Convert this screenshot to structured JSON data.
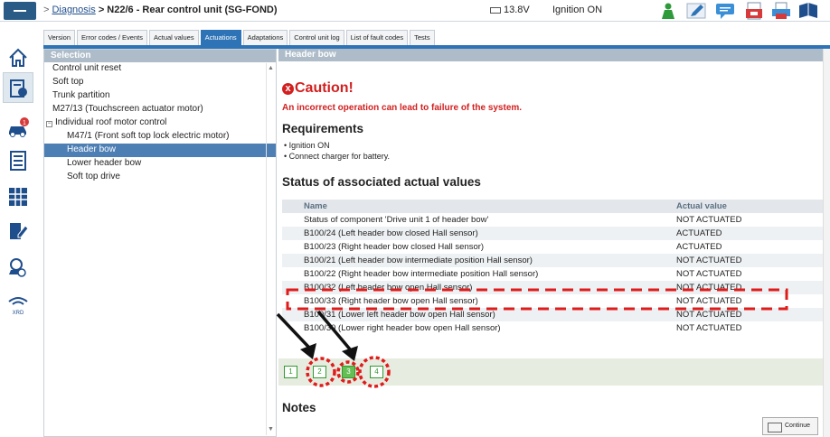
{
  "breadcrumb": {
    "separator": ">",
    "link": "Diagnosis",
    "current": "> N22/6 - Rear control unit (SG-FOND)"
  },
  "status": {
    "voltage": "13.8V",
    "ignition": "Ignition ON"
  },
  "toolbar_icons": [
    "person-icon",
    "pencil-icon",
    "chat-icon",
    "document-red-icon",
    "print-icon",
    "book-icon"
  ],
  "tabs": [
    "Version",
    "Error codes / Events",
    "Actual values",
    "Actuations",
    "Adaptations",
    "Control unit log",
    "List of fault codes",
    "Tests"
  ],
  "active_tab": "Actuations",
  "rail_icons": [
    "home-icon",
    "vehicle-info-icon",
    "car-alert-icon",
    "list-icon",
    "grid-icon",
    "edit-doc-icon",
    "car-search-icon",
    "xrd-icon"
  ],
  "rail_badge": "1",
  "rail_label": "XRD",
  "selection": {
    "title": "Selection",
    "items": [
      {
        "label": "Control unit reset",
        "level": 0
      },
      {
        "label": "Soft top",
        "level": 0
      },
      {
        "label": "Trunk partition",
        "level": 0
      },
      {
        "label": "M27/13 (Touchscreen actuator motor)",
        "level": 0
      },
      {
        "label": "Individual roof motor control",
        "level": 0,
        "expander": "−"
      },
      {
        "label": "M47/1 (Front soft top lock electric motor)",
        "level": 1
      },
      {
        "label": "Header bow",
        "level": 1,
        "selected": true
      },
      {
        "label": "Lower header bow",
        "level": 1
      },
      {
        "label": "Soft top drive",
        "level": 1
      }
    ]
  },
  "main": {
    "title": "Header bow",
    "caution_icon": "x",
    "caution": "Caution!",
    "caution_text": "An incorrect operation can lead to failure of the system.",
    "requirements_title": "Requirements",
    "requirements": [
      "Ignition ON",
      "Connect charger for battery."
    ],
    "status_title": "Status of associated actual values",
    "table": {
      "headers": [
        "Name",
        "Actual value"
      ],
      "rows": [
        [
          "Status of component 'Drive unit 1 of header bow'",
          "NOT ACTUATED"
        ],
        [
          "B100/24 (Left header bow closed Hall sensor)",
          "ACTUATED"
        ],
        [
          "B100/23 (Right header bow closed Hall sensor)",
          "ACTUATED"
        ],
        [
          "B100/21 (Left header bow intermediate position Hall sensor)",
          "NOT ACTUATED"
        ],
        [
          "B100/22 (Right header bow intermediate position Hall sensor)",
          "NOT ACTUATED"
        ],
        [
          "B100/32 (Left header bow open Hall sensor)",
          "NOT ACTUATED"
        ],
        [
          "B100/33 (Right header bow open Hall sensor)",
          "NOT ACTUATED"
        ],
        [
          "B100/31 (Lower left header bow open Hall sensor)",
          "NOT ACTUATED"
        ],
        [
          "B100/30 (Lower right header bow open Hall sensor)",
          "NOT ACTUATED"
        ]
      ]
    },
    "pages": [
      "1",
      "2",
      "3",
      "4"
    ],
    "active_page": "3",
    "notes_title": "Notes",
    "continue_label": "Continue"
  },
  "colors": {
    "header_blue": "#2e73b6",
    "selection_blue": "#4d7fb5",
    "caution_red": "#d21f1f",
    "page_green": "#2f9b2f",
    "annotation_red": "#e01b1b"
  }
}
